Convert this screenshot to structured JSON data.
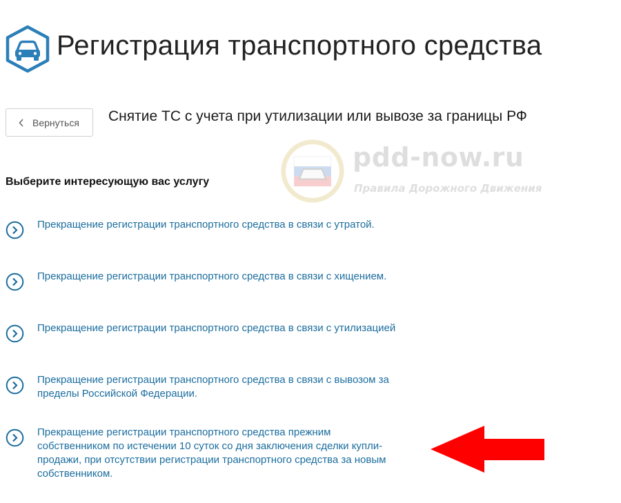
{
  "header": {
    "title": "Регистрация транспортного средства",
    "icon": "car-icon",
    "accent_color": "#2b7fb8"
  },
  "back_button": {
    "label": "Вернуться",
    "icon": "chevron-left-icon"
  },
  "subtitle": "Снятие ТС с учета при утилизации или вывозе за границы РФ",
  "watermark": {
    "domain": "pdd-now.ru",
    "tagline": "Правила Дорожного Движения",
    "icon": "traffic-police-emblem-icon"
  },
  "section_heading": "Выберите интересующую вас услугу",
  "services": [
    {
      "label": "Прекращение регистрации транспортного средства в связи с утратой."
    },
    {
      "label": "Прекращение регистрации транспортного средства в связи с хищением."
    },
    {
      "label": "Прекращение регистрации транспортного средства в связи с утилизацией"
    },
    {
      "label": "Прекращение регистрации транспортного средства в связи с вывозом за пределы Российской Федерации."
    },
    {
      "label": "Прекращение регистрации транспортного средства прежним собственником по истечении 10 суток со дня заключения сделки купли-продажи, при отсутствии регистрации транспортного средства за новым собственником."
    }
  ],
  "link_color": "#1b6d9e",
  "highlight_arrow": {
    "icon": "arrow-left-icon",
    "color": "#ff0000"
  }
}
